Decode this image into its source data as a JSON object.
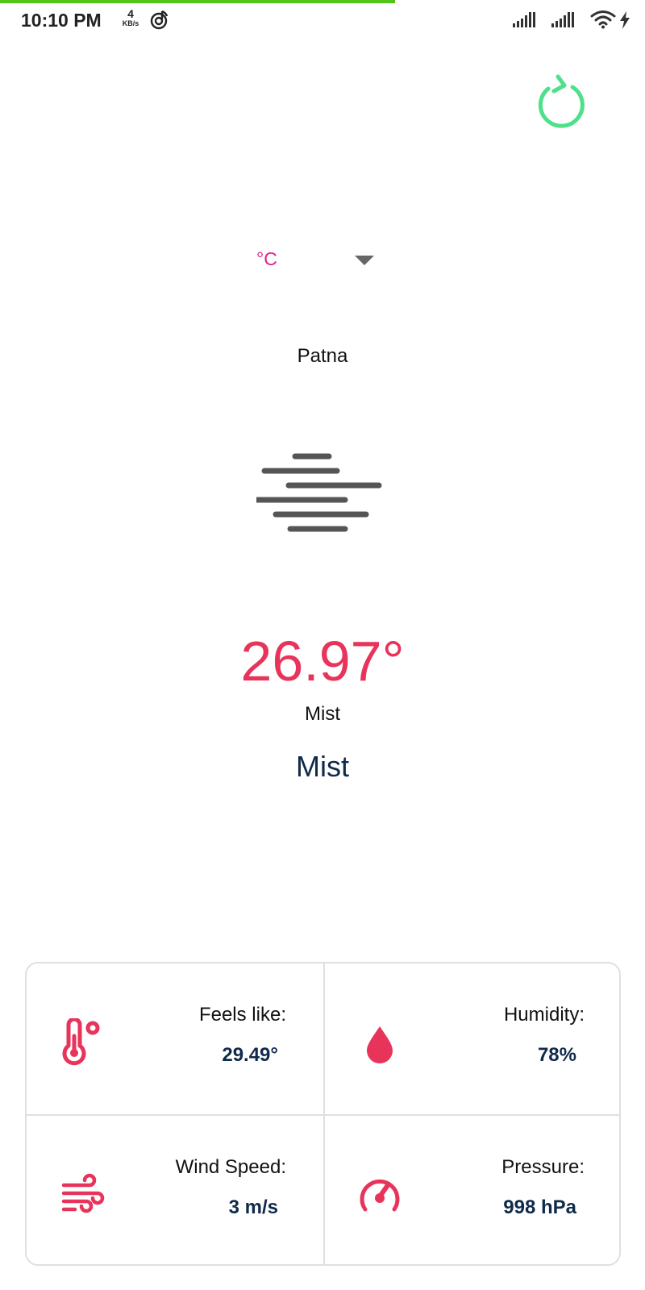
{
  "status_bar": {
    "time": "10:10 PM",
    "net_speed_value": "4",
    "net_speed_unit": "KB/s"
  },
  "controls": {
    "refresh_icon": "refresh-icon",
    "unit_selected": "°C"
  },
  "weather": {
    "city": "Patna",
    "icon": "mist-icon",
    "temperature": "26.97°",
    "main": "Mist",
    "description": "Mist"
  },
  "details": {
    "feels_like": {
      "label": "Feels like:",
      "value": "29.49°",
      "icon": "thermometer-icon"
    },
    "humidity": {
      "label": "Humidity:",
      "value": "78%",
      "icon": "water-drop-icon"
    },
    "wind_speed": {
      "label": "Wind Speed:",
      "value": "3 m/s",
      "icon": "wind-icon"
    },
    "pressure": {
      "label": "Pressure:",
      "value": "998 hPa",
      "icon": "gauge-icon"
    }
  },
  "colors": {
    "accent_red": "#e8335a",
    "refresh_green": "#4ee08a",
    "unit_pink": "#e0218a",
    "value_navy": "#0f2a4a",
    "load_bar_green": "#52c41a"
  }
}
